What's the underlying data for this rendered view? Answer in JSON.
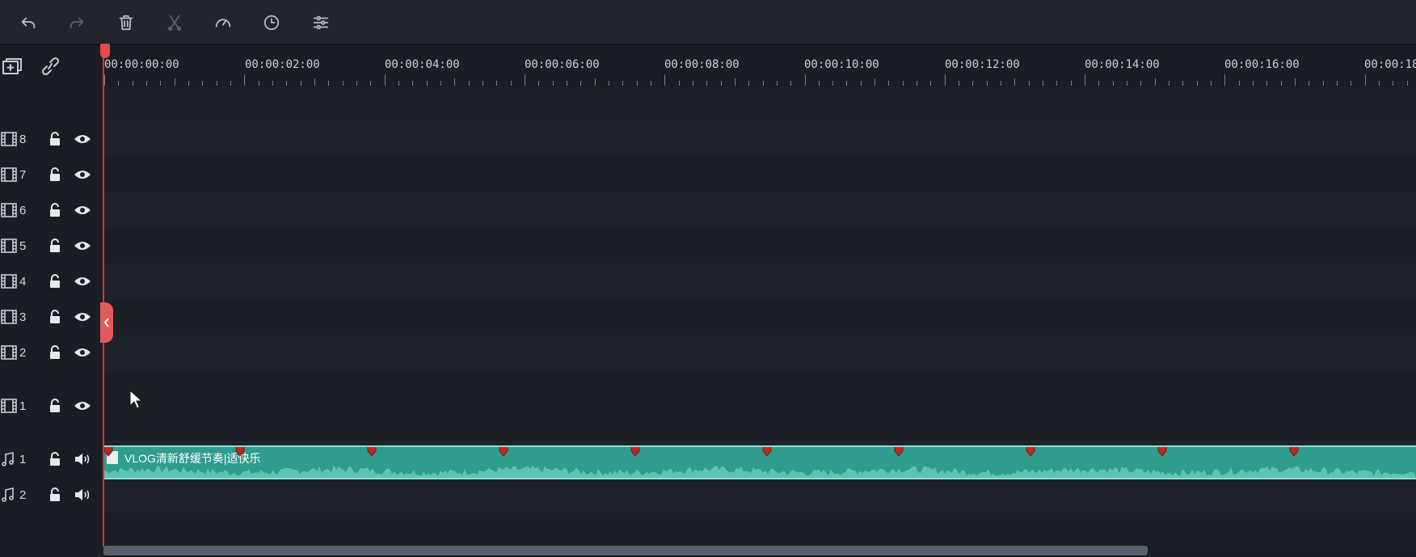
{
  "toolbar": {
    "buttons": [
      {
        "name": "undo-button",
        "icon": "undo-icon",
        "enabled": true
      },
      {
        "name": "redo-button",
        "icon": "redo-icon",
        "enabled": false
      },
      {
        "name": "delete-button",
        "icon": "trash-icon",
        "enabled": true
      },
      {
        "name": "cut-button",
        "icon": "scissors-icon",
        "enabled": false
      },
      {
        "name": "speed-button",
        "icon": "speedometer-icon",
        "enabled": true
      },
      {
        "name": "duration-button",
        "icon": "clock-icon",
        "enabled": true
      },
      {
        "name": "adjust-button",
        "icon": "sliders-icon",
        "enabled": true
      }
    ]
  },
  "header_tools": [
    {
      "name": "add-track-button",
      "icon": "add-track-icon"
    },
    {
      "name": "link-button",
      "icon": "link-icon"
    }
  ],
  "ruler": {
    "labels": [
      "00:00:00:00",
      "00:00:02:00",
      "00:00:04:00",
      "00:00:06:00",
      "00:00:08:00",
      "00:00:10:00",
      "00:00:12:00",
      "00:00:14:00",
      "00:00:16:00",
      "00:00:18"
    ]
  },
  "video_tracks": [
    {
      "number": "8",
      "icon": "film-icon"
    },
    {
      "number": "7",
      "icon": "film-icon"
    },
    {
      "number": "6",
      "icon": "film-icon"
    },
    {
      "number": "5",
      "icon": "film-icon"
    },
    {
      "number": "4",
      "icon": "film-icon"
    },
    {
      "number": "3",
      "icon": "film-icon"
    },
    {
      "number": "2",
      "icon": "film-icon"
    },
    {
      "number": "1",
      "icon": "film-icon"
    }
  ],
  "audio_tracks": [
    {
      "number": "1",
      "icon": "music-note-icon"
    },
    {
      "number": "2",
      "icon": "music-note-icon"
    }
  ],
  "audio_clip": {
    "title": "VLOG清新舒缓节奏|适快乐",
    "marker_count": 11
  },
  "colors": {
    "playhead": "#d2363a",
    "clip": "#2f9c8e",
    "clip_border": "#8fe0d4",
    "marker": "#c0281e"
  }
}
